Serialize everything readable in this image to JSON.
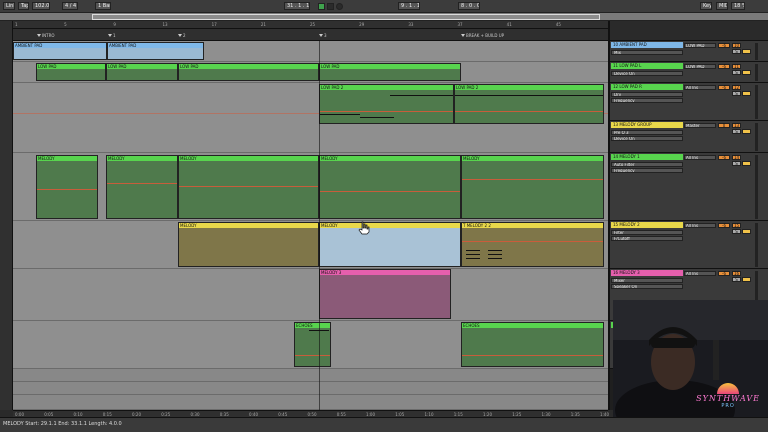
{
  "transport": {
    "link": "Link",
    "tap": "Tap",
    "tempo": "102.00",
    "signature": "4 / 4",
    "quantize": "1 Bar",
    "position": "31 . 1 . 1",
    "loop_start": "9 . 1 . 1",
    "loop_length": "8 . 0 . 0",
    "key": "Key",
    "midi": "MIDI",
    "cpu": "18 %"
  },
  "ruler": {
    "bars": [
      "1",
      "5",
      "9",
      "13",
      "17",
      "21",
      "25",
      "29",
      "33",
      "37",
      "41",
      "45"
    ]
  },
  "locators": [
    {
      "label": "INTRO"
    },
    {
      "label": "1"
    },
    {
      "label": "2"
    },
    {
      "label": "3"
    },
    {
      "label": "BREAK + BUILD UP"
    }
  ],
  "tracks": [
    {
      "id": "ambient",
      "clips": [
        {
          "label": "AMBIENT PAD"
        },
        {
          "label": "AMBIENT PAD"
        }
      ]
    },
    {
      "id": "lowpad1",
      "clips": [
        {
          "label": "LOW PAD"
        },
        {
          "label": "LOW PAD"
        },
        {
          "label": "LOW PAD"
        },
        {
          "label": "LOW PAD"
        }
      ]
    },
    {
      "id": "lowpad2",
      "clips": [
        {
          "label": "LOW PAD 2"
        },
        {
          "label": "LOW PAD 2"
        }
      ]
    },
    {
      "id": "melody1",
      "clips": [
        {
          "label": "MELODY"
        },
        {
          "label": "MELODY"
        },
        {
          "label": "MELODY"
        },
        {
          "label": "MELODY"
        },
        {
          "label": "MELODY"
        }
      ]
    },
    {
      "id": "melody2",
      "clips": [
        {
          "label": "MELODY"
        },
        {
          "label": "MELODY"
        },
        {
          "label": "T MELODY 2 2"
        }
      ]
    },
    {
      "id": "melody3",
      "clips": [
        {
          "label": "MELODY 3"
        }
      ]
    },
    {
      "id": "echoes",
      "clips": [
        {
          "label": "ECHOES"
        },
        {
          "label": "ECHOES"
        }
      ]
    }
  ],
  "mixer": [
    {
      "title": "10 AMBIENT PAD",
      "color": "#7fb8e8",
      "field1": "Mix",
      "field2": "",
      "io": "LOW PAD",
      "vol": "-6",
      "num": "10"
    },
    {
      "title": "11 LOW PAD L",
      "color": "#58d44e",
      "field1": "Device On",
      "field2": "",
      "io": "LOW PAD",
      "vol": "-6",
      "num": "11"
    },
    {
      "title": "12 LOW PAD R",
      "color": "#58d44e",
      "field1": "Drv",
      "field2": "Frequency",
      "io": "All Ins",
      "vol": "-6",
      "num": "12"
    },
    {
      "title": "13 MELODY GROUP",
      "color": "#e9d84a",
      "field1": "Pre Q 3",
      "field2": "Device On",
      "io": "Master",
      "vol": "0",
      "num": "13"
    },
    {
      "title": "14 MELODY 1",
      "color": "#58d44e",
      "field1": "Auto Filter",
      "field2": "Frequency",
      "io": "All Ins",
      "vol": "-6",
      "num": "14"
    },
    {
      "title": "15 MELODY 2",
      "color": "#e9d84a",
      "field1": "Filter",
      "field2": "F/Cutoff",
      "io": "All Ins",
      "vol": "-6",
      "num": "15"
    },
    {
      "title": "16 MELODY 3",
      "color": "#e55fad",
      "field1": "Mixer",
      "field2": "Speaker On",
      "io": "All Ins",
      "vol": "-6",
      "num": "16"
    },
    {
      "title": "17 ECHOES",
      "color": "#58d44e",
      "field1": "",
      "field2": "",
      "io": "All Ins",
      "vol": "-6",
      "num": "17"
    }
  ],
  "time_axis": [
    "0:00",
    "0:05",
    "0:10",
    "0:15",
    "0:20",
    "0:25",
    "0:30",
    "0:35",
    "0:40",
    "0:45",
    "0:50",
    "0:55",
    "1:00",
    "1:05",
    "1:10",
    "1:15",
    "1:20",
    "1:25",
    "1:30",
    "1:35",
    "1:40"
  ],
  "status": "MELODY  Start: 29.1.1  End: 33.1.1  Length: 4.0.0",
  "overlay": {
    "brand_line1": "SYNTHWAVE",
    "brand_line2": "PRO"
  }
}
